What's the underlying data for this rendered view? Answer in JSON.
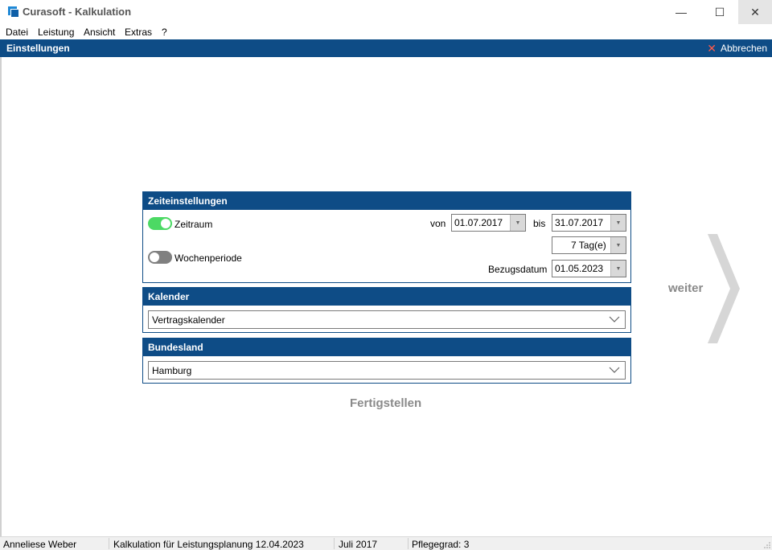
{
  "window": {
    "title": "Curasoft - Kalkulation",
    "controls": {
      "minimize": "—",
      "maximize": "☐",
      "close": "✕"
    }
  },
  "menu": [
    "Datei",
    "Leistung",
    "Ansicht",
    "Extras",
    "?"
  ],
  "header": {
    "title": "Einstellungen",
    "cancel_label": "Abbrechen",
    "cancel_icon": "close-icon"
  },
  "time_settings": {
    "title": "Zeiteinstellungen",
    "zeitraum": {
      "label": "Zeitraum",
      "enabled": true
    },
    "wochenperiode": {
      "label": "Wochenperiode",
      "enabled": false
    },
    "von_label": "von",
    "von_value": "01.07.2017",
    "bis_label": "bis",
    "bis_value": "31.07.2017",
    "days_value": "7 Tag(e)",
    "bezugsdatum_label": "Bezugsdatum",
    "bezugsdatum_value": "01.05.2023"
  },
  "calendar": {
    "title": "Kalender",
    "selected": "Vertragskalender"
  },
  "state": {
    "title": "Bundesland",
    "selected": "Hamburg"
  },
  "actions": {
    "finish_label": "Fertigstellen",
    "next_label": "weiter"
  },
  "status": {
    "user": "Anneliese Weber",
    "calculation": "Kalkulation für Leistungsplanung 12.04.2023",
    "month": "Juli 2017",
    "care_level": "Pflegegrad: 3"
  },
  "colors": {
    "header": "#0e4c86",
    "toggle_on": "#4cd964",
    "toggle_off": "#808080",
    "accent_text": "#8a8a8a"
  }
}
